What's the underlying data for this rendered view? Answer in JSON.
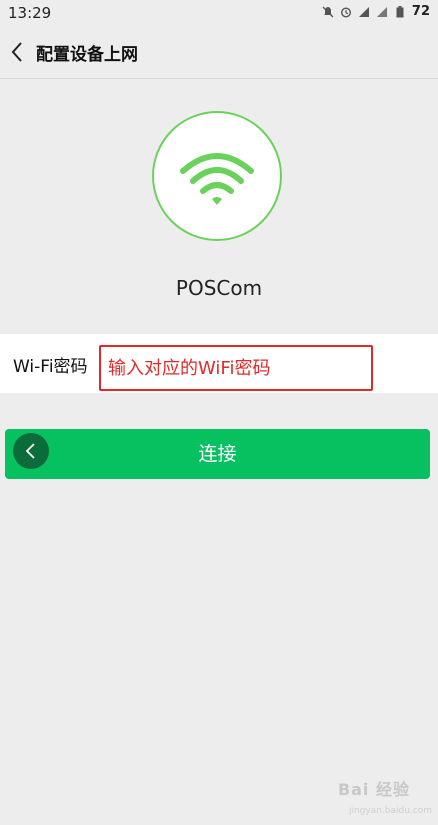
{
  "status_bar": {
    "time": "13:29",
    "battery": "72",
    "icons": [
      "mute-icon",
      "alarm-icon",
      "signal-icon",
      "signal-icon",
      "battery-icon"
    ]
  },
  "nav": {
    "title": "配置设备上网",
    "back_icon": "chevron-left-icon"
  },
  "device": {
    "icon": "wifi-icon",
    "name": "POSCom"
  },
  "password": {
    "label": "Wi-Fi密码",
    "value": "",
    "annotation": "输入对应的WiFi密码"
  },
  "connect_button": {
    "label": "连接"
  },
  "watermark": {
    "text": "Bai 经验",
    "sub": "jingyan.baidu.com"
  },
  "colors": {
    "accent_green": "#07c160",
    "wifi_green": "#6ad25b",
    "annotation_red": "#e12a2a"
  }
}
